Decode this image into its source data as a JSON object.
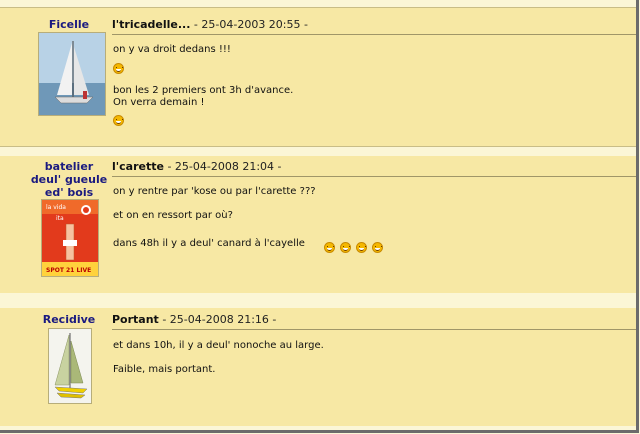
{
  "posts": [
    {
      "author": "Ficelle",
      "title": "l'tricadelle...",
      "date": " - 25-04-2003 20:55 -",
      "lines": [
        "on y va droit dedans !!!",
        "bon les 2 premiers ont 3h d'avance.",
        "On verra demain !"
      ],
      "avatar_icon": "sailboat-photo-icon"
    },
    {
      "author_lines": [
        "batelier",
        "deul' gueule",
        "ed' bois"
      ],
      "title": "l'carette",
      "date": " - 25-04-2008 21:04 -",
      "lines": [
        "on y rentre par 'kose ou par l'carette ???",
        "et on en ressort par où?",
        "dans 48h il y a deul' canard à l'cayelle"
      ],
      "avatar_icon": "poster-icon",
      "avatar_text": [
        "la vida",
        "ita",
        "SPOT 21 LIVE"
      ]
    },
    {
      "author": "Recidive",
      "title": "Portant",
      "date": " - 25-04-2008 21:16 -",
      "lines": [
        "et dans 10h, il y a deul' nonoche au large.",
        "Faible, mais portant."
      ],
      "avatar_icon": "catamaran-icon"
    }
  ],
  "colors": {
    "post_bg": "#f7e8a4",
    "page_bg": "#fbf6d6",
    "author": "#1a1a80"
  }
}
